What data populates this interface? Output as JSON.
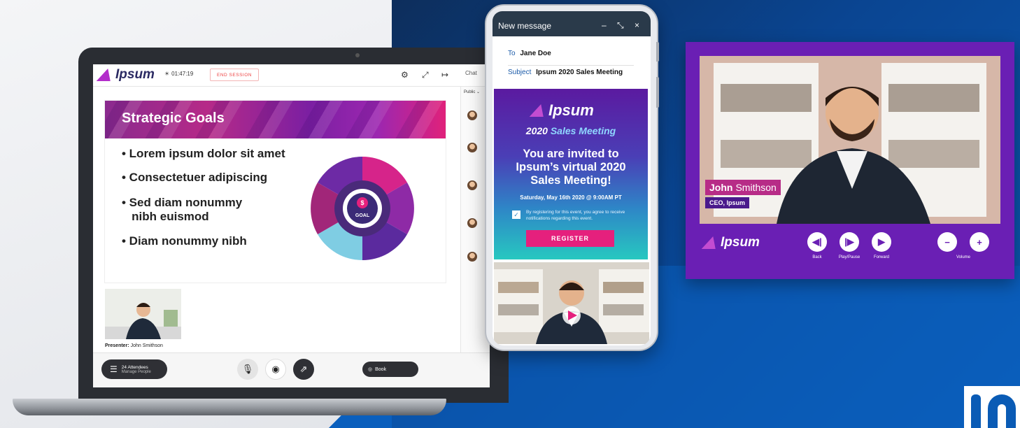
{
  "laptop": {
    "app": {
      "logo_text": "Ipsum",
      "timer": "01:47:19",
      "end_session_label": "END SESSION",
      "chat_tab_label": "Chat",
      "chat_public_label": "Public ⌄",
      "header_icons": [
        "gear-icon",
        "expand-icon",
        "exit-icon"
      ]
    },
    "slide": {
      "title": "Strategic Goals",
      "bullets": [
        "• Lorem ipsum dolor sit amet",
        "• Consectetuer adipiscing",
        "• Sed diam nonummy\n   nibh euismod",
        "• Diam nonummy nibh"
      ],
      "wheel_center_label": "GOAL"
    },
    "presenter": {
      "label_prefix": "Presenter:",
      "name": "John Smithson"
    },
    "bottom_bar": {
      "attendees_count": "24 Attendees",
      "attendees_sub": "Manage People",
      "book_label": "Book"
    }
  },
  "phone": {
    "header_title": "New message",
    "header_controls": "– ⤡ ×",
    "to_label": "To",
    "to_value": "Jane Doe",
    "subject_label": "Subject",
    "subject_value": "Ipsum 2020 Sales Meeting",
    "invite": {
      "logo_text": "Ipsum",
      "year": "2020",
      "year_suffix": "Sales Meeting",
      "headline": "You are invited to Ipsum’s virtual 2020 Sales Meeting!",
      "date": "Saturday, May 16th 2020 @ 9:00AM PT",
      "consent": "By registering for this event, you agree to receive notifications regarding this event.",
      "register_label": "REGISTER"
    }
  },
  "player": {
    "name_first": "John",
    "name_last": "Smithson",
    "title": "CEO, Ipsum",
    "logo_text": "Ipsum",
    "controls": {
      "back": "Back",
      "play_pause": "Play/Pause",
      "forward": "Forward",
      "volume": "Volume"
    }
  },
  "colors": {
    "brand_purple": "#6a1fb4",
    "brand_pink": "#e5207d",
    "brand_navy": "#2b2a63",
    "background_blue": "#0a5bb5"
  }
}
